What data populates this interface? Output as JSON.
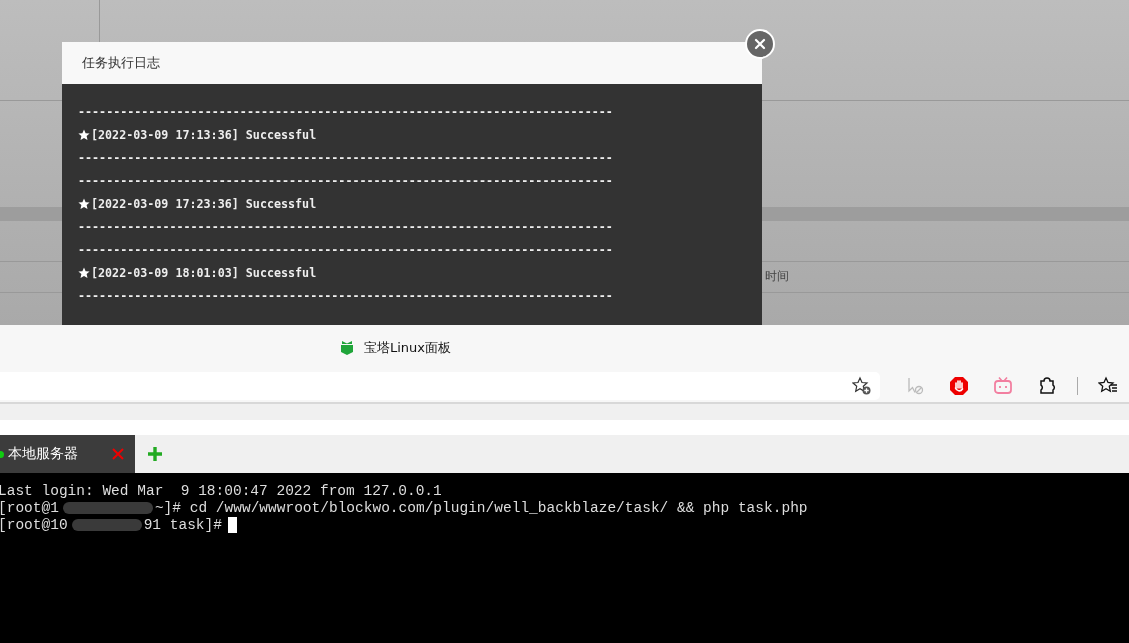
{
  "background": {
    "column_header": "时间"
  },
  "log_dialog": {
    "title": "任务执行日志",
    "lines": [
      {
        "kind": "rule",
        "text": "----------------------------------------------------------------------------"
      },
      {
        "kind": "entry",
        "text": "[2022-03-09 17:13:36] Successful"
      },
      {
        "kind": "rule",
        "text": "----------------------------------------------------------------------------"
      },
      {
        "kind": "rule",
        "text": "----------------------------------------------------------------------------"
      },
      {
        "kind": "entry",
        "text": "[2022-03-09 17:23:36] Successful"
      },
      {
        "kind": "rule",
        "text": "----------------------------------------------------------------------------"
      },
      {
        "kind": "rule",
        "text": "----------------------------------------------------------------------------"
      },
      {
        "kind": "entry",
        "text": "[2022-03-09 18:01:03] Successful"
      },
      {
        "kind": "rule",
        "text": "----------------------------------------------------------------------------"
      }
    ]
  },
  "browser": {
    "tab_title": "宝塔Linux面板"
  },
  "terminal": {
    "tabs": [
      {
        "label": "本地服务器",
        "selected": true
      }
    ],
    "lines": [
      {
        "parts": [
          "Last login: Wed Mar  9 18:00:47 2022 from 127.0.0.1"
        ]
      },
      {
        "parts": [
          "[root@1",
          "~]# cd /www/wwwroot/blockwo.com/plugin/well_backblaze/task/ && php task.php"
        ]
      },
      {
        "parts": [
          "[root@10",
          "91 task]#"
        ]
      }
    ]
  }
}
